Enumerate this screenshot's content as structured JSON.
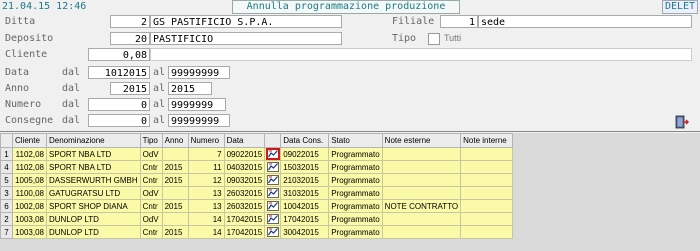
{
  "header": {
    "datetime": "21.04.15 12:46",
    "title": "Annulla programmazione produzione",
    "mode": "DELET"
  },
  "form": {
    "ditta": {
      "label": "Ditta",
      "code": "2",
      "name": "GS PASTIFICIO S.P.A."
    },
    "deposito": {
      "label": "Deposito",
      "code": "20",
      "name": "PASTIFICIO"
    },
    "cliente": {
      "label": "Cliente",
      "code": "0,08",
      "name": ""
    },
    "data": {
      "label": "Data",
      "dal_label": "dal",
      "dal": "1012015",
      "al_label": "al",
      "al": "99999999"
    },
    "anno": {
      "label": "Anno",
      "dal_label": "dal",
      "dal": "2015",
      "al_label": "al",
      "al": "2015"
    },
    "numero": {
      "label": "Numero",
      "dal_label": "dal",
      "dal": "0",
      "al_label": "al",
      "al": "9999999"
    },
    "consegne": {
      "label": "Consegne",
      "dal_label": "dal",
      "dal": "0",
      "al_label": "al",
      "al": "99999999"
    },
    "filiale": {
      "label": "Filiale",
      "code": "1",
      "name": "sede"
    },
    "tipo": {
      "label": "Tipo",
      "option": "Tutti"
    }
  },
  "table": {
    "columns": [
      "",
      "Cliente",
      "Denominazione",
      "Tipo",
      "Anno",
      "Numero",
      "Data",
      "",
      "Data Cons.",
      "Stato",
      "Note esterne",
      "Note interne"
    ],
    "rows": [
      {
        "n": "1",
        "cliente": "1102,08",
        "den": "SPORT NBA LTD",
        "tipo": "OdV",
        "anno": "",
        "numero": "7",
        "data": "09022015",
        "cons": "09022015",
        "stato": "Programmato",
        "note_est": "",
        "note_int": ""
      },
      {
        "n": "4",
        "cliente": "1102,08",
        "den": "SPORT NBA LTD",
        "tipo": "Cntr",
        "anno": "2015",
        "numero": "11",
        "data": "04032015",
        "cons": "15032015",
        "stato": "Programmato",
        "note_est": "",
        "note_int": ""
      },
      {
        "n": "5",
        "cliente": "1005,08",
        "den": "DASSERWURTH GMBH",
        "tipo": "Cntr",
        "anno": "2015",
        "numero": "12",
        "data": "09032015",
        "cons": "21032015",
        "stato": "Programmato",
        "note_est": "",
        "note_int": ""
      },
      {
        "n": "3",
        "cliente": "1100,08",
        "den": "GATUGRATSU LTD",
        "tipo": "OdV",
        "anno": "",
        "numero": "13",
        "data": "26032015",
        "cons": "31032015",
        "stato": "Programmato",
        "note_est": "",
        "note_int": ""
      },
      {
        "n": "6",
        "cliente": "1002,08",
        "den": "SPORT SHOP DIANA",
        "tipo": "Cntr",
        "anno": "2015",
        "numero": "13",
        "data": "26032015",
        "cons": "10042015",
        "stato": "Programmato",
        "note_est": "NOTE CONTRATTO",
        "note_int": ""
      },
      {
        "n": "2",
        "cliente": "1003,08",
        "den": "DUNLOP LTD",
        "tipo": "OdV",
        "anno": "",
        "numero": "14",
        "data": "17042015",
        "cons": "17042015",
        "stato": "Programmato",
        "note_est": "",
        "note_int": ""
      },
      {
        "n": "7",
        "cliente": "1003,08",
        "den": "DUNLOP LTD",
        "tipo": "Cntr",
        "anno": "2015",
        "numero": "14",
        "data": "17042015",
        "cons": "30042015",
        "stato": "Programmato",
        "note_est": "",
        "note_int": ""
      }
    ]
  },
  "colors": {
    "row_bg": "#fafaa8",
    "selection": "#d01818",
    "accent": "#1a7a8a"
  },
  "icons": {
    "row_action": "schedule-chart-icon",
    "exit": "exit-door-icon"
  }
}
